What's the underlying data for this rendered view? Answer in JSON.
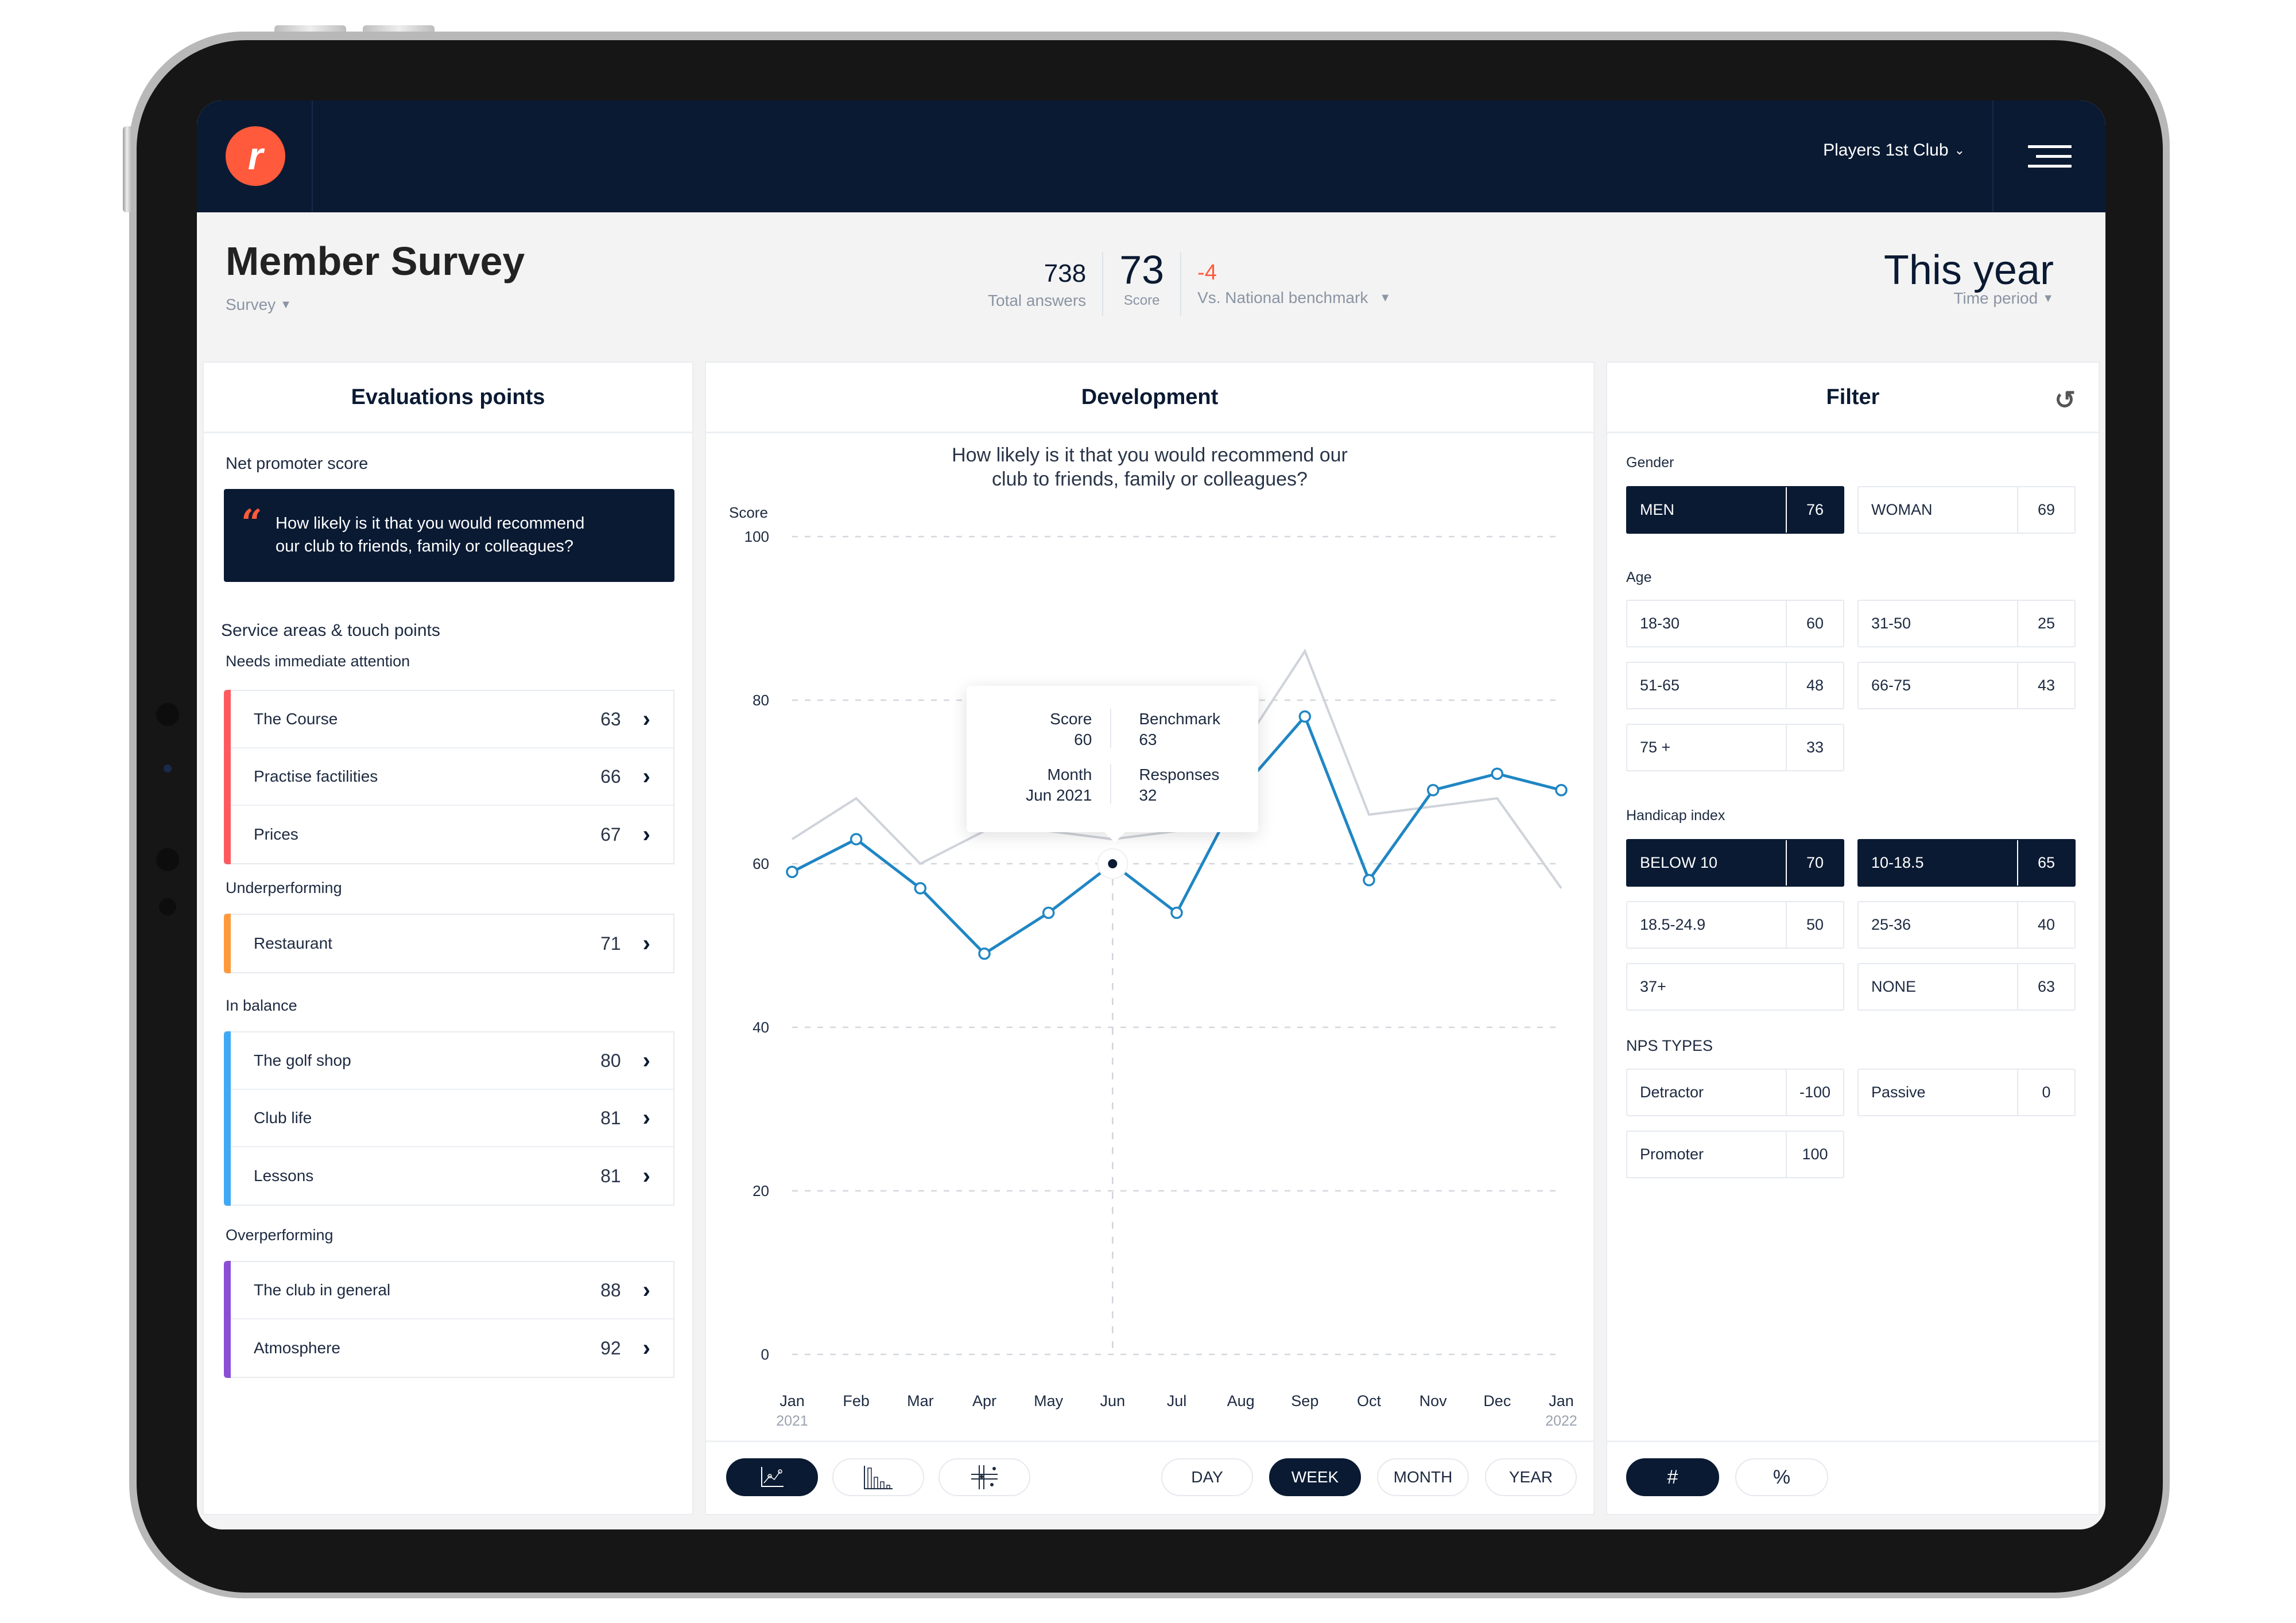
{
  "app": {
    "club_selector": "Players 1st Club",
    "logo_glyph": "r"
  },
  "header": {
    "title": "Member Survey",
    "survey_dropdown": "Survey",
    "total_answers": "738",
    "total_answers_label": "Total answers",
    "score": "73",
    "score_label": "Score",
    "benchmark_diff": "-4",
    "benchmark_label": "Vs. National benchmark",
    "time_period": "This year",
    "time_period_label": "Time period"
  },
  "evaluations": {
    "title": "Evaluations points",
    "nps_label": "Net promoter score",
    "nps_question": "How likely is it that you would recommend our club to friends, family or colleagues?",
    "nps_question_line1": "How likely is it that you would recommend",
    "nps_question_line2": "our club to friends, family or colleagues?",
    "service_label": "Service areas & touch points",
    "groups": [
      {
        "label": "Needs immediate attention",
        "color": "#ff5a5f",
        "items": [
          {
            "name": "The Course",
            "value": "63"
          },
          {
            "name": "Practise factilities",
            "value": "66"
          },
          {
            "name": "Prices",
            "value": "67"
          }
        ]
      },
      {
        "label": "Underperforming",
        "color": "#ff9a3c",
        "items": [
          {
            "name": "Restaurant",
            "value": "71"
          }
        ]
      },
      {
        "label": "In balance",
        "color": "#3fa9f5",
        "items": [
          {
            "name": "The golf shop",
            "value": "80"
          },
          {
            "name": "Club life",
            "value": "81"
          },
          {
            "name": "Lessons",
            "value": "81"
          }
        ]
      },
      {
        "label": "Overperforming",
        "color": "#8a4fd6",
        "items": [
          {
            "name": "The club in general",
            "value": "88"
          },
          {
            "name": "Atmosphere",
            "value": "92"
          }
        ]
      }
    ]
  },
  "development": {
    "title": "Development",
    "question_line1": "How likely is it that you would recommend our",
    "question_line2": "club to friends, family or colleagues?",
    "tooltip": {
      "score_label": "Score",
      "score_value": "60",
      "benchmark_label": "Benchmark",
      "benchmark_value": "63",
      "month_label": "Month",
      "month_value": "Jun 2021",
      "responses_label": "Responses",
      "responses_value": "32"
    },
    "chart_types": [
      "line-chart-icon",
      "bar-chart-icon",
      "scatter-chart-icon"
    ],
    "active_chart_type": 0,
    "granularity": [
      "DAY",
      "WEEK",
      "MONTH",
      "YEAR"
    ],
    "active_granularity": 1
  },
  "chart_data": {
    "type": "line",
    "title": "How likely is it that you would recommend our club to friends, family or colleagues?",
    "xlabel": "",
    "ylabel": "Score",
    "categories": [
      "Jan",
      "Feb",
      "Mar",
      "Apr",
      "May",
      "Jun",
      "Jul",
      "Aug",
      "Sep",
      "Oct",
      "Nov",
      "Dec",
      "Jan"
    ],
    "category_years": [
      "2021",
      "",
      "",
      "",
      "",
      "",
      "",
      "",
      "",
      "",
      "",
      "",
      "2022"
    ],
    "yticks": [
      0,
      20,
      40,
      60,
      80,
      100
    ],
    "ylim": [
      0,
      100
    ],
    "grid": true,
    "highlighted_index": 5,
    "series": [
      {
        "name": "Score",
        "color": "#1f86c4",
        "values": [
          59,
          63,
          57,
          49,
          54,
          60,
          54,
          69,
          78,
          58,
          69,
          71,
          69
        ]
      },
      {
        "name": "Benchmark",
        "color": "#cfd3da",
        "values": [
          63,
          68,
          60,
          64,
          64,
          63,
          64,
          74,
          86,
          66,
          67,
          68,
          57
        ]
      }
    ]
  },
  "filter": {
    "title": "Filter",
    "sections": [
      {
        "label": "Gender",
        "chips": [
          {
            "label": "MEN",
            "value": "76",
            "active": true
          },
          {
            "label": "WOMAN",
            "value": "69",
            "active": false
          }
        ]
      },
      {
        "label": "Age",
        "chips": [
          {
            "label": "18-30",
            "value": "60",
            "active": false
          },
          {
            "label": "31-50",
            "value": "25",
            "active": false
          },
          {
            "label": "51-65",
            "value": "48",
            "active": false
          },
          {
            "label": "66-75",
            "value": "43",
            "active": false
          },
          {
            "label": "75 +",
            "value": "33",
            "active": false
          }
        ]
      },
      {
        "label": "Handicap index",
        "chips": [
          {
            "label": "BELOW 10",
            "value": "70",
            "active": true
          },
          {
            "label": "10-18.5",
            "value": "65",
            "active": true
          },
          {
            "label": "18.5-24.9",
            "value": "50",
            "active": false
          },
          {
            "label": "25-36",
            "value": "40",
            "active": false
          },
          {
            "label": "37+",
            "value": "",
            "active": false
          },
          {
            "label": "NONE",
            "value": "63",
            "active": false
          }
        ]
      },
      {
        "label": "NPS TYPES",
        "chips": [
          {
            "label": "Detractor",
            "value": "-100",
            "active": false
          },
          {
            "label": "Passive",
            "value": "0",
            "active": false
          },
          {
            "label": "Promoter",
            "value": "100",
            "active": false
          }
        ]
      }
    ],
    "units": [
      "#",
      "%"
    ],
    "active_unit": 0
  }
}
